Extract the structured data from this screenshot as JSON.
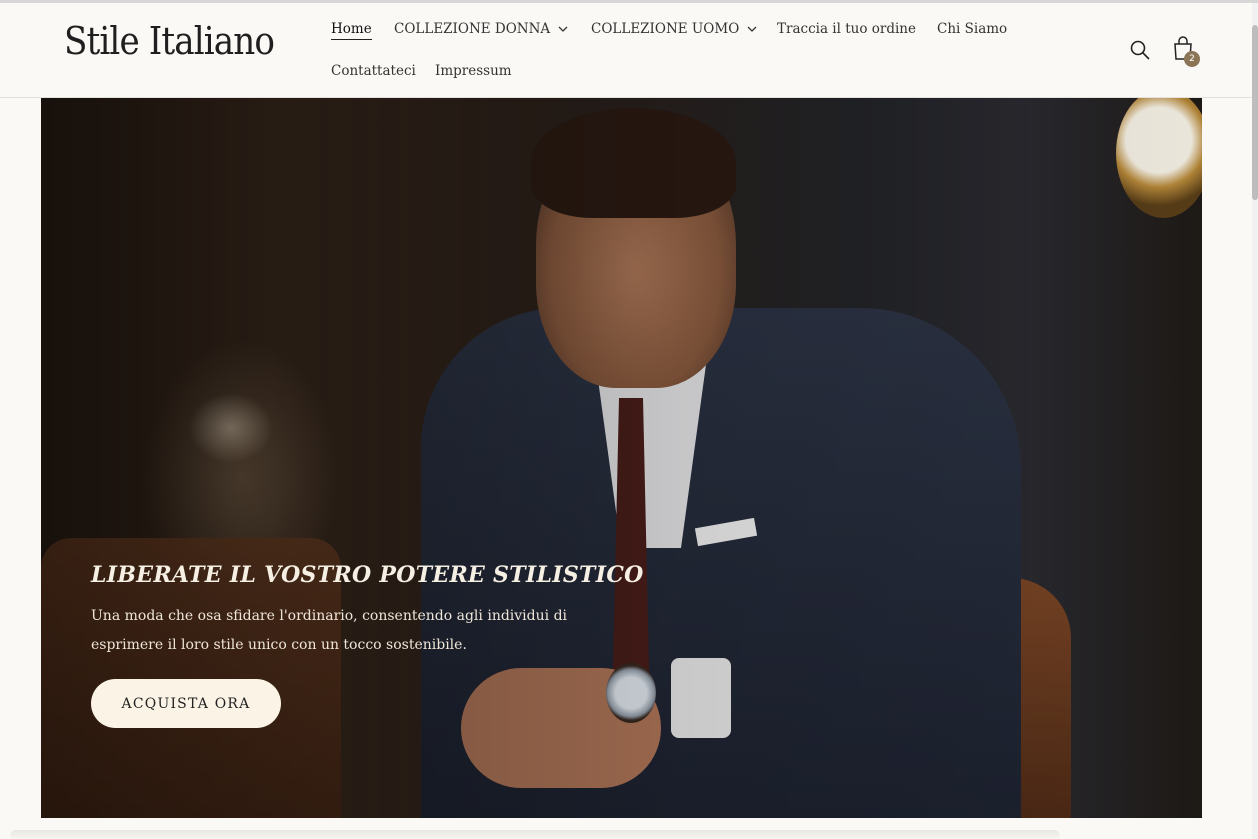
{
  "brand": {
    "logo_text": "Stile Italiano"
  },
  "nav": {
    "items": [
      {
        "label": "Home",
        "active": true
      },
      {
        "label": "COLLEZIONE DONNA",
        "has_dropdown": true
      },
      {
        "label": "COLLEZIONE UOMO",
        "has_dropdown": true
      },
      {
        "label": "Traccia il tuo ordine"
      },
      {
        "label": "Chi Siamo"
      },
      {
        "label": "Contattateci"
      },
      {
        "label": "Impressum"
      }
    ]
  },
  "header_actions": {
    "search_icon": "search-icon",
    "cart_icon": "shopping-bag-icon",
    "cart_count": "2"
  },
  "hero": {
    "title": "LIBERATE IL VOSTRO POTERE STILISTICO",
    "subtitle": "Una moda che osa sfidare l'ordinario, consentendo agli individui di esprimere il loro stile unico con un tocco sostenibile.",
    "cta_label": "ACQUISTA ORA"
  },
  "colors": {
    "page_bg": "#faf9f5",
    "badge": "#8b7557",
    "cta_bg": "#fbf4e6",
    "hero_text": "#f6efe4"
  }
}
